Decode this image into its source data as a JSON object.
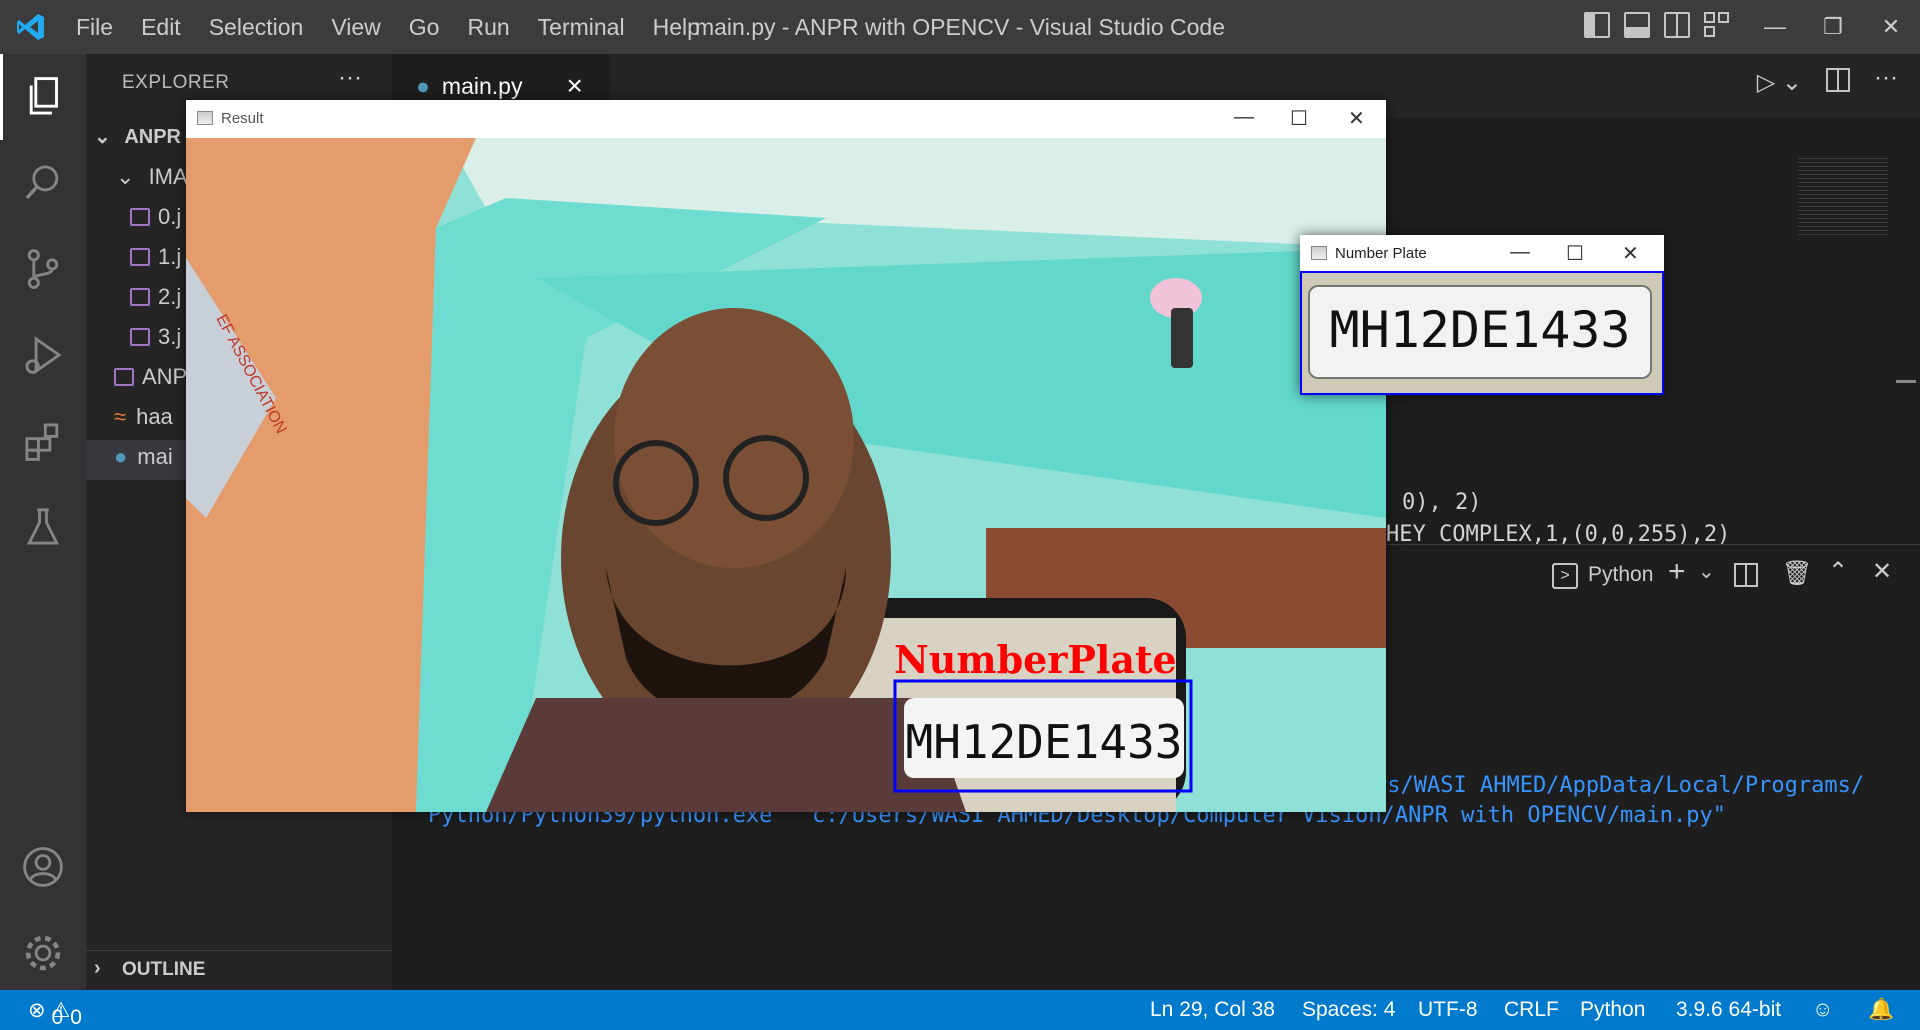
{
  "window": {
    "title": "main.py - ANPR with OPENCV - Visual Studio Code",
    "menu": [
      "File",
      "Edit",
      "Selection",
      "View",
      "Go",
      "Run",
      "Terminal",
      "Help"
    ]
  },
  "sidebar": {
    "header": "EXPLORER",
    "more": "···",
    "root": "ANPR",
    "folder": "IMA",
    "files": [
      "0.j",
      "1.j",
      "2.j",
      "3.j"
    ],
    "other_files": [
      "ANP",
      "haa",
      "mai"
    ],
    "outline": "OUTLINE"
  },
  "tabs": [
    {
      "label": "main.py",
      "close": "×"
    }
  ],
  "editor": {
    "code_lines": [
      "0), 2)",
      "HEY_COMPLEX,1,(0,0,255),2)"
    ]
  },
  "panel": {
    "terminal_name": "Python",
    "lines": [
      "rs/WASI AHMED/AppData/Local/Programs/",
      "Python/Python39/python.exe  \"c:/Users/WASI AHMED/Desktop/Computer Vision/ANPR with OPENCV/main.py\""
    ]
  },
  "status": {
    "errors": "0",
    "warnings": "0",
    "position": "Ln 29, Col 38",
    "spaces": "Spaces: 4",
    "encoding": "UTF-8",
    "eol": "CRLF",
    "language": "Python",
    "interpreter": "3.9.6 64-bit"
  },
  "result_window": {
    "title": "Result",
    "overlay_label": "NumberPlate",
    "plate_text": "MH12DE1433",
    "poster_text": "EF ASSOCIATION"
  },
  "plate_window": {
    "title": "Number Plate",
    "plate_text": "MH12DE1433"
  },
  "colors": {
    "accent": "#007acc",
    "overlay_label": "#ff0000",
    "detection_box": "#0000ff"
  }
}
